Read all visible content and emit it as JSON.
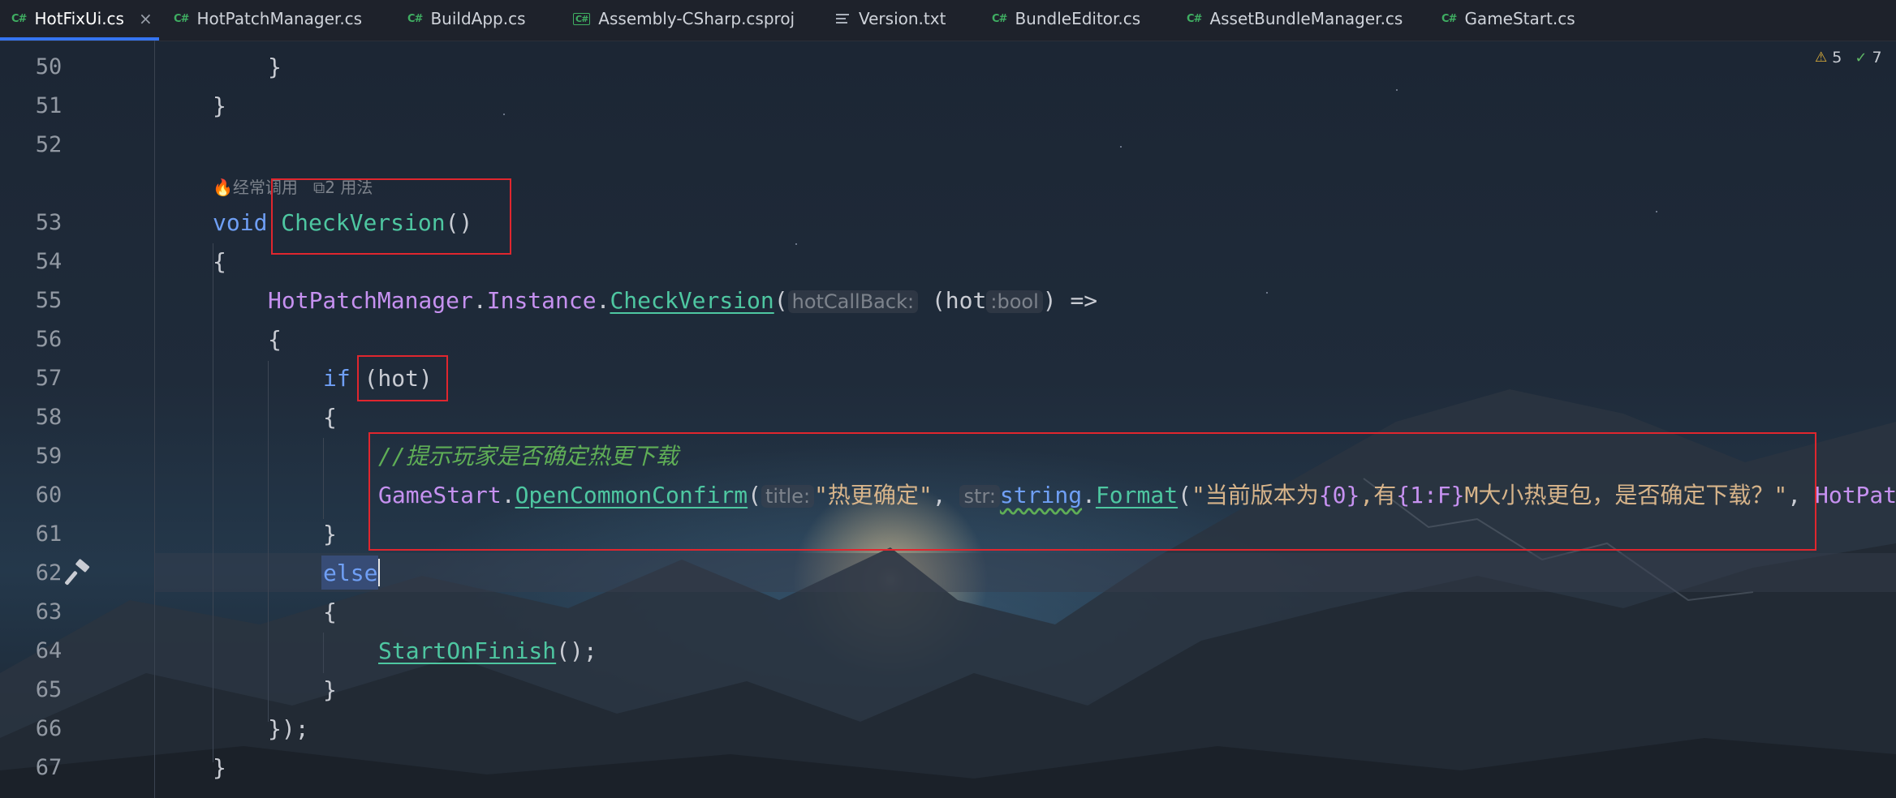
{
  "tabs": [
    {
      "icon": "C#",
      "label": "HotFixUi.cs",
      "active": true,
      "closable": true
    },
    {
      "icon": "C#",
      "label": "HotPatchManager.cs"
    },
    {
      "icon": "C#",
      "label": "BuildApp.cs"
    },
    {
      "icon": "C#",
      "label": "Assembly-CSharp.csproj"
    },
    {
      "icon": "text-file-icon",
      "label": "Version.txt"
    },
    {
      "icon": "C#",
      "label": "BundleEditor.cs"
    },
    {
      "icon": "C#",
      "label": "AssetBundleManager.cs"
    },
    {
      "icon": "C#",
      "label": "GameStart.cs"
    }
  ],
  "inspections": {
    "warnings": "5",
    "ok": "7"
  },
  "line_numbers": [
    "50",
    "51",
    "52",
    "53",
    "54",
    "55",
    "56",
    "57",
    "58",
    "59",
    "60",
    "61",
    "62",
    "63",
    "64",
    "65",
    "66",
    "67"
  ],
  "code_meta": {
    "frequent": "经常调用",
    "usages": "2 用法"
  },
  "code": {
    "l50": "}",
    "l51": "}",
    "l53_kw": "void",
    "l53_fn": "CheckVersion",
    "l53_rest": "()",
    "l54": "{",
    "l55_cls": "HotPatchManager",
    "l55_dot1": ".",
    "l55_prop": "Instance",
    "l55_dot2": ".",
    "l55_fn": "CheckVersion",
    "l55_paren": "(",
    "l55_hint1": "hotCallBack:",
    "l55_open": " (hot",
    "l55_hint2": ":bool",
    "l55_close": ") =>",
    "l56": "{",
    "l57_kw": "if",
    "l57_rest": " (hot)",
    "l58": "{",
    "l59_comment": "//提示玩家是否确定热更下载",
    "l60_cls": "GameStart",
    "l60_dot": ".",
    "l60_fn": "OpenCommonConfirm",
    "l60_paren": "(",
    "l60_hint1": "title:",
    "l60_str1": "\"热更确定\"",
    "l60_comma": ",",
    "l60_hint2": "str:",
    "l60_kw": "string",
    "l60_dot2": ".",
    "l60_fn2": "Format",
    "l60_paren2": "(",
    "l60_str2a": "\"当前版本为",
    "l60_fmt1": "{0}",
    "l60_str2b": ",有",
    "l60_fmt2": "{1:F}",
    "l60_str2c": "M大小热更包，是否确定下载？\"",
    "l60_comma2": ", ",
    "l60_cls2": "HotPat",
    "l61": "}",
    "l62_kw": "else",
    "l63": "{",
    "l64_fn": "StartOnFinish",
    "l64_rest": "();",
    "l65": "}",
    "l66": "});",
    "l67": "}"
  },
  "colors": {
    "highlight_box": "#e0262e",
    "active_tab_underline": "#3574f0",
    "keyword": "#6f9ff5",
    "method": "#4ec7a1",
    "class": "#c691f0",
    "string": "#d7b48a",
    "comment": "#5fae56"
  }
}
